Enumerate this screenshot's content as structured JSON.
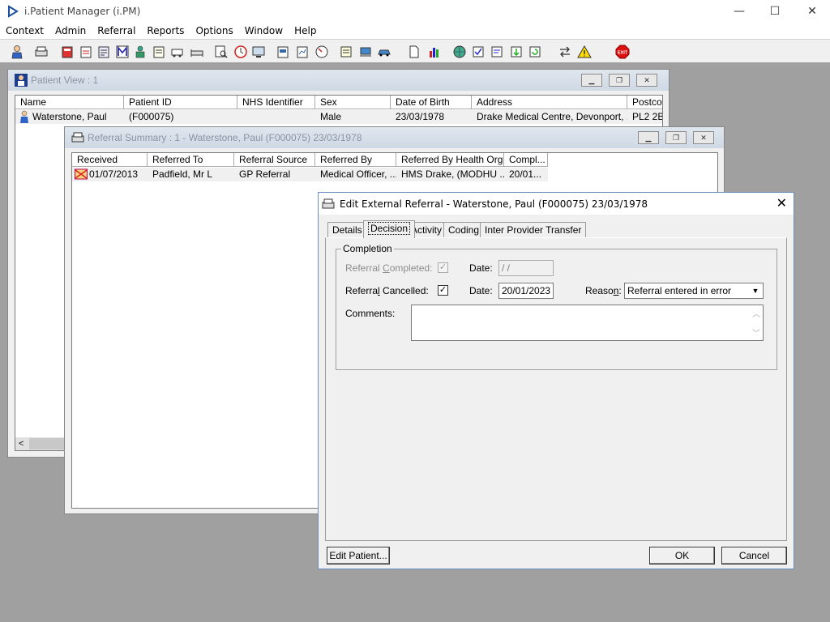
{
  "app": {
    "title": "i.Patient Manager (i.PM)"
  },
  "window_controls": {
    "minimize": "—",
    "maximize": "☐",
    "close": "✕"
  },
  "menu": [
    "Context",
    "Admin",
    "Referral",
    "Reports",
    "Options",
    "Window",
    "Help"
  ],
  "toolbar": {
    "icons": [
      "patient-icon",
      "print-icon",
      "book-icon",
      "notes-icon",
      "document-icon",
      "m-icon",
      "person-icon",
      "form-icon",
      "ambulance-icon",
      "bed-icon",
      "search-doc-icon",
      "clock-icon",
      "monitor-icon",
      "report-icon",
      "chart-doc-icon",
      "gauge-icon",
      "note-icon",
      "transport-icon",
      "car-icon",
      "page-icon",
      "bar-chart-icon",
      "globe-icon",
      "check-list-icon",
      "edit-list-icon",
      "down-list-icon",
      "refresh-list-icon",
      "swap-icon",
      "warning-icon",
      "exit-icon"
    ],
    "exit_label": "EXIT"
  },
  "patient_view": {
    "title": "Patient View : 1",
    "columns": [
      "Name",
      "Patient ID",
      "NHS Identifier",
      "Sex",
      "Date of Birth",
      "Address",
      "Postcod"
    ],
    "rows": [
      {
        "name": "Waterstone, Paul",
        "patient_id": "(F000075)",
        "nhs": "",
        "sex": "Male",
        "dob": "23/03/1978",
        "address": "Drake Medical Centre, Devonport, ...",
        "postcode": "PL2 2B"
      }
    ]
  },
  "referral_summary": {
    "title": "Referral Summary : 1 - Waterstone, Paul (F000075) 23/03/1978",
    "columns": [
      "Received",
      "Referred To",
      "Referral Source",
      "Referred By",
      "Referred By Health Org.",
      "Compl..."
    ],
    "rows": [
      {
        "received": "01/07/2013",
        "referred_to": "Padfield, Mr L",
        "source": "GP Referral",
        "referred_by": "Medical Officer, ...",
        "org": "HMS Drake, (MODHU ...",
        "completed": "20/01..."
      }
    ]
  },
  "dialog": {
    "title": "Edit External Referral - Waterstone, Paul (F000075) 23/03/1978",
    "tabs": [
      "Details",
      "Decision",
      "Activity",
      "Coding",
      "Inter Provider Transfer"
    ],
    "active_tab": "Decision",
    "group_title": "Completion",
    "referral_completed_label_pre": "Referral ",
    "referral_completed_label_ul": "C",
    "referral_completed_label_post": "ompleted:",
    "referral_completed_checked": true,
    "date_label": "Date:",
    "completed_date": "/ /",
    "referral_cancelled_label_pre": "Referra",
    "referral_cancelled_label_ul": "l",
    "referral_cancelled_label_post": " Cancelled:",
    "referral_cancelled_checked": true,
    "cancelled_date": "20/01/2023",
    "reason_label_pre": "Reaso",
    "reason_label_ul": "n",
    "reason_label_post": ":",
    "reason_value": "Referral entered in error",
    "comments_label": "Comments:",
    "comments_value": "",
    "edit_patient_button": "Edit Patient...",
    "ok_button": "OK",
    "cancel_button": "Cancel",
    "checkmark": "✓"
  }
}
